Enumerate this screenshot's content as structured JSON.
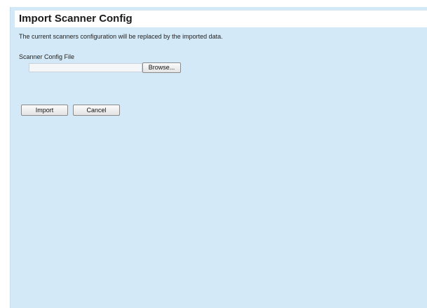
{
  "page": {
    "title": "Import Scanner Config",
    "description": "The current scanners configuration will be replaced by the imported data."
  },
  "form": {
    "file_label": "Scanner Config File",
    "file_value": "",
    "browse_label": "Browse..."
  },
  "actions": {
    "import_label": "Import",
    "cancel_label": "Cancel"
  },
  "colors": {
    "panel_background": "#d3e9f7",
    "title_bar_background": "#ffffff"
  }
}
